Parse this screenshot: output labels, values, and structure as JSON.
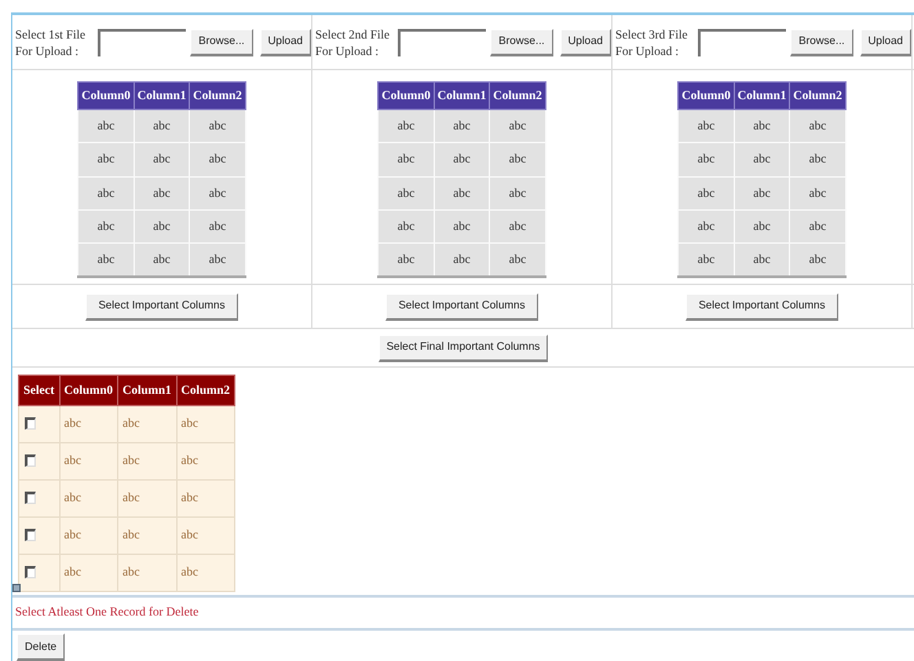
{
  "uploads": [
    {
      "label": "Select 1st File For Upload :",
      "browse_button": "Browse...",
      "upload_button": "Upload",
      "table": {
        "columns": [
          "Column0",
          "Column1",
          "Column2"
        ],
        "rows": [
          [
            "abc",
            "abc",
            "abc"
          ],
          [
            "abc",
            "abc",
            "abc"
          ],
          [
            "abc",
            "abc",
            "abc"
          ],
          [
            "abc",
            "abc",
            "abc"
          ],
          [
            "abc",
            "abc",
            "abc"
          ]
        ]
      },
      "select_button": "Select Important Columns"
    },
    {
      "label": "Select 2nd File For Upload :",
      "browse_button": "Browse...",
      "upload_button": "Upload",
      "table": {
        "columns": [
          "Column0",
          "Column1",
          "Column2"
        ],
        "rows": [
          [
            "abc",
            "abc",
            "abc"
          ],
          [
            "abc",
            "abc",
            "abc"
          ],
          [
            "abc",
            "abc",
            "abc"
          ],
          [
            "abc",
            "abc",
            "abc"
          ],
          [
            "abc",
            "abc",
            "abc"
          ]
        ]
      },
      "select_button": "Select Important Columns"
    },
    {
      "label": "Select 3rd File For Upload :",
      "browse_button": "Browse...",
      "upload_button": "Upload",
      "table": {
        "columns": [
          "Column0",
          "Column1",
          "Column2"
        ],
        "rows": [
          [
            "abc",
            "abc",
            "abc"
          ],
          [
            "abc",
            "abc",
            "abc"
          ],
          [
            "abc",
            "abc",
            "abc"
          ],
          [
            "abc",
            "abc",
            "abc"
          ],
          [
            "abc",
            "abc",
            "abc"
          ]
        ]
      },
      "select_button": "Select Important Columns"
    }
  ],
  "final_button": "Select Final Important Columns",
  "result_table": {
    "checkbox_column_header": "Select",
    "columns": [
      "Column0",
      "Column1",
      "Column2"
    ],
    "rows": [
      {
        "checked": false,
        "cells": [
          "abc",
          "abc",
          "abc"
        ]
      },
      {
        "checked": false,
        "cells": [
          "abc",
          "abc",
          "abc"
        ]
      },
      {
        "checked": false,
        "cells": [
          "abc",
          "abc",
          "abc"
        ]
      },
      {
        "checked": false,
        "cells": [
          "abc",
          "abc",
          "abc"
        ]
      },
      {
        "checked": false,
        "cells": [
          "abc",
          "abc",
          "abc"
        ]
      }
    ]
  },
  "message": "Select Atleast One Record for Delete",
  "delete_button": "Delete"
}
